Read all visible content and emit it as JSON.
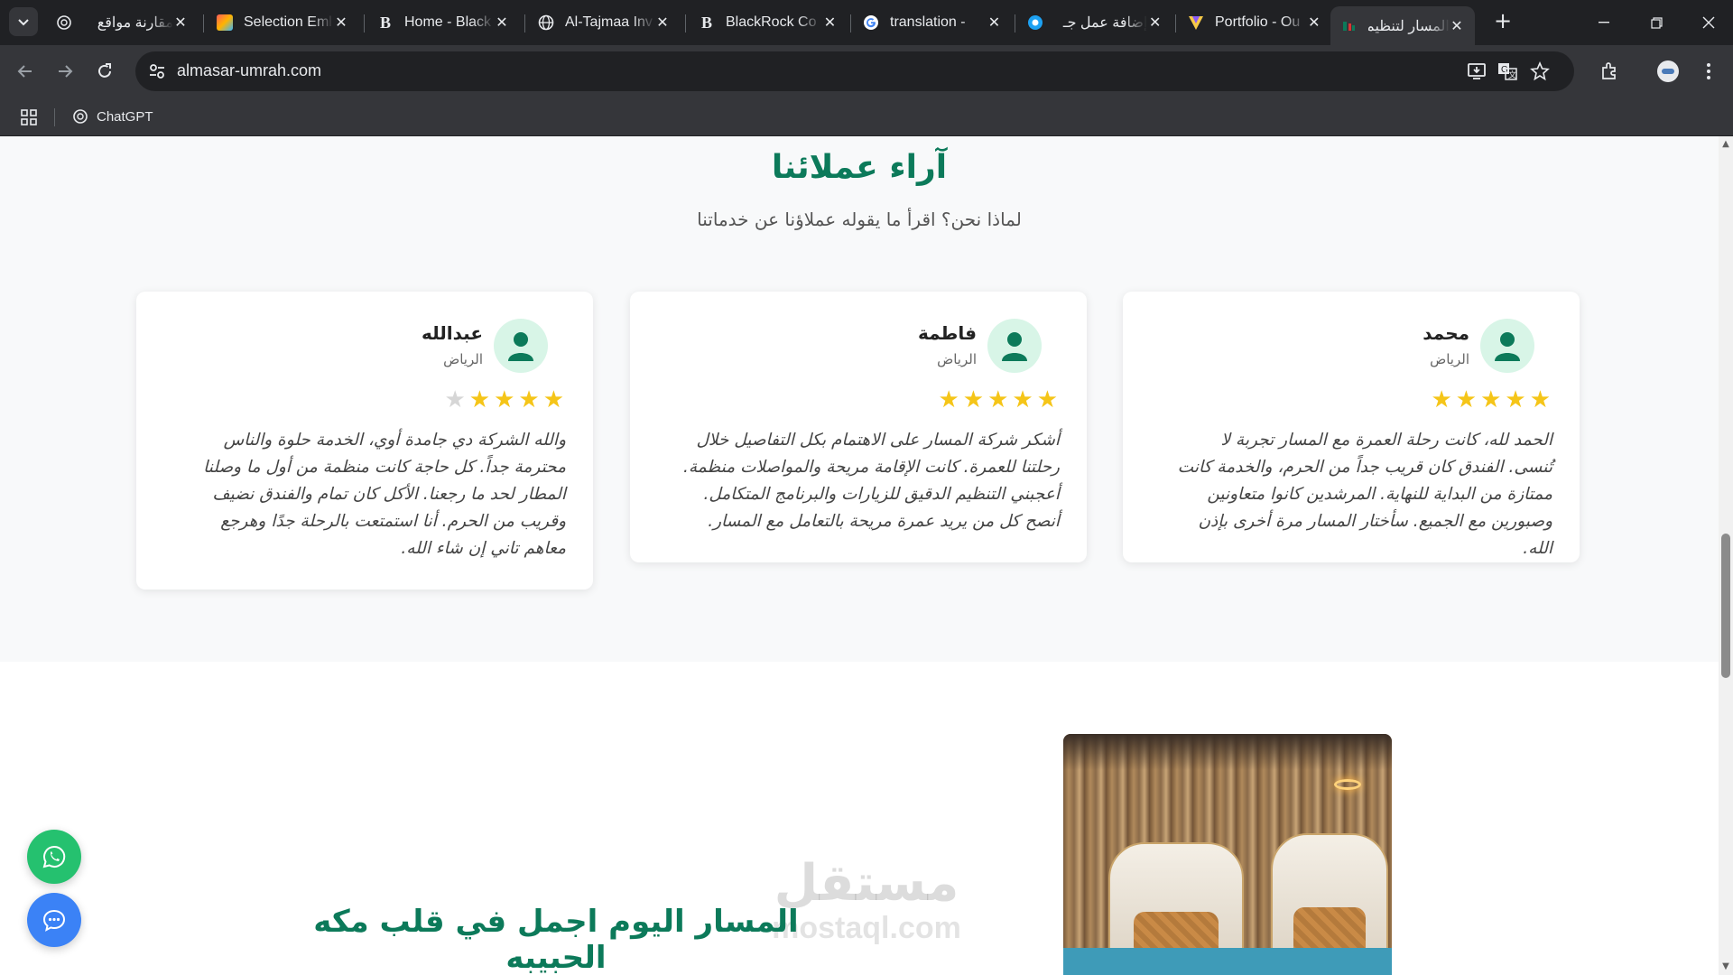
{
  "browser": {
    "tabs": [
      {
        "title": "مقارنة مواقع"
      },
      {
        "title": "Selection Eml"
      },
      {
        "title": "Home - Black"
      },
      {
        "title": "Al-Tajmaa Inv"
      },
      {
        "title": "BlackRock Co"
      },
      {
        "title": "translation - "
      },
      {
        "title": "إضافة عمل جـ"
      },
      {
        "title": "Portfolio - Ou"
      },
      {
        "title": "المسار لتنظيم"
      }
    ],
    "address": "almasar-umrah.com",
    "bookmarks": [
      {
        "label": "ChatGPT"
      }
    ]
  },
  "testimonials": {
    "title": "آراء عملائنا",
    "subtitle": "لماذا نحن؟ اقرأ ما يقوله عملاؤنا عن خدماتنا",
    "cards": [
      {
        "name": "محمد",
        "city": "الرياض",
        "rating": 5,
        "text": "الحمد لله، كانت رحلة العمرة مع المسار تجربة لا تُنسى. الفندق كان قريب جداً من الحرم، والخدمة كانت ممتازة من البداية للنهاية. المرشدين كانوا متعاونين وصبورين مع الجميع. سأختار المسار مرة أخرى بإذن الله."
      },
      {
        "name": "فاطمة",
        "city": "الرياض",
        "rating": 5,
        "text": "أشكر شركة المسار على الاهتمام بكل التفاصيل خلال رحلتنا للعمرة. كانت الإقامة مريحة والمواصلات منظمة. أعجبني التنظيم الدقيق للزيارات والبرنامج المتكامل. أنصح كل من يريد عمرة مريحة بالتعامل مع المسار."
      },
      {
        "name": "عبدالله",
        "city": "الرياض",
        "rating": 4,
        "text": "والله الشركة دي جامدة أوي، الخدمة حلوة والناس محترمة جداً. كل حاجة كانت منظمة من أول ما وصلنا المطار لحد ما رجعنا. الأكل كان تمام والفندق نضيف وقريب من الحرم. أنا استمتعت بالرحلة جدًا وهرجع معاهم تاني إن شاء الله."
      }
    ]
  },
  "about": {
    "title": "المسار اليوم اجمل في قلب مكه الحبيبه"
  },
  "watermark": {
    "ar": "مستقل",
    "en": "mostaql.com"
  },
  "colors": {
    "brand_green": "#0c7a5a",
    "star_yellow": "#f5c518",
    "whatsapp_green": "#25c16f",
    "chat_blue": "#3b82f6"
  }
}
